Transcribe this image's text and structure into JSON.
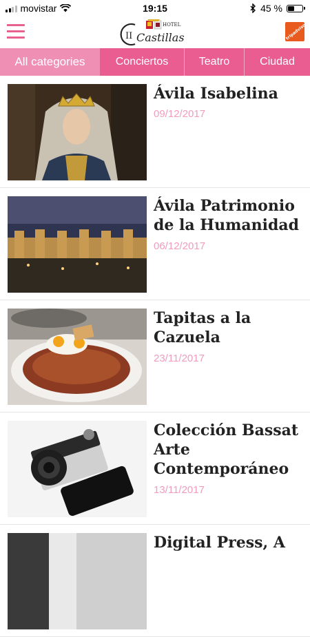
{
  "status_bar": {
    "carrier": "movistar",
    "time": "19:15",
    "battery": "45 %"
  },
  "header": {
    "logo_text": "Castillas",
    "logo_numeral": "II",
    "logo_small": "HOTEL",
    "tripadvisor_label": "tripadvisor"
  },
  "tabs": [
    {
      "label": "All categories"
    },
    {
      "label": "Conciertos"
    },
    {
      "label": "Teatro"
    },
    {
      "label": "Ciudad"
    }
  ],
  "articles": [
    {
      "title": "Ávila Isabelina",
      "date": "09/12/2017"
    },
    {
      "title": "Ávila Patrimonio de la Humanidad",
      "date": "06/12/2017"
    },
    {
      "title": "Tapitas a la Cazuela",
      "date": "23/11/2017"
    },
    {
      "title": "Colección Bassat Arte Contemporáneo",
      "date": "13/11/2017"
    },
    {
      "title": "Digital Press, A"
    }
  ],
  "colors": {
    "accent": "#ea5d91",
    "active_tab": "#f08fb4",
    "date": "#ef9cbd",
    "tripadvisor": "#e85a1e"
  }
}
